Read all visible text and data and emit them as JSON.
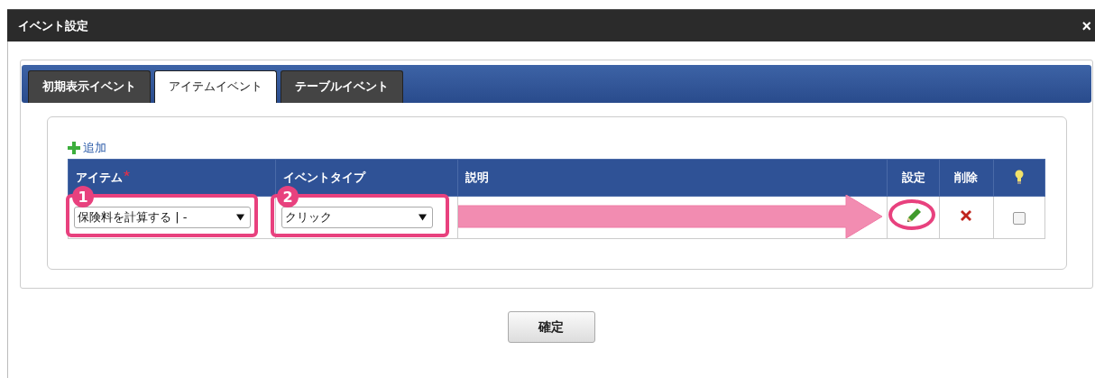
{
  "window": {
    "title": "イベント設定",
    "close": "×"
  },
  "tabs": [
    {
      "label": "初期表示イベント",
      "selected": false
    },
    {
      "label": "アイテムイベント",
      "selected": true
    },
    {
      "label": "テーブルイベント",
      "selected": false
    }
  ],
  "add_link": "追加",
  "table": {
    "columns": [
      {
        "label": "アイテム",
        "required": true
      },
      {
        "label": "イベントタイプ",
        "required": false
      },
      {
        "label": "説明",
        "required": false
      },
      {
        "label": "設定",
        "required": false
      },
      {
        "label": "削除",
        "required": false
      }
    ],
    "rows": [
      {
        "item": "保険料を計算する | -",
        "event_type": "クリック",
        "enabled": false
      }
    ]
  },
  "callouts": [
    {
      "number": "1"
    },
    {
      "number": "2"
    }
  ],
  "confirm_button": "確定"
}
